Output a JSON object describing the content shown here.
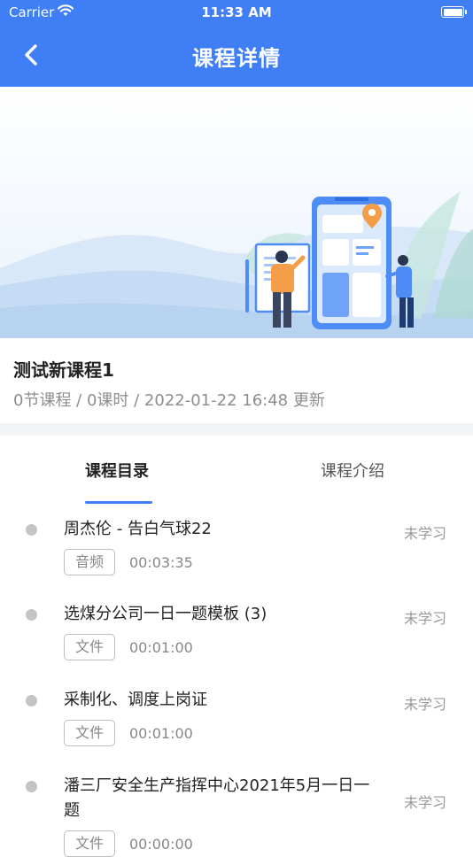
{
  "status_bar": {
    "carrier": "Carrier",
    "time": "11:33 AM"
  },
  "header": {
    "title": "课程详情"
  },
  "course": {
    "title": "测试新课程1",
    "meta": "0节课程 / 0课时 / 2022-01-22 16:48 更新"
  },
  "tabs": [
    {
      "label": "课程目录",
      "active": true
    },
    {
      "label": "课程介绍",
      "active": false
    }
  ],
  "lessons": [
    {
      "title": "周杰伦 - 告白气球22",
      "type": "音频",
      "duration": "00:03:35",
      "status": "未学习"
    },
    {
      "title": "选煤分公司一日一题模板 (3)",
      "type": "文件",
      "duration": "00:01:00",
      "status": "未学习"
    },
    {
      "title": "采制化、调度上岗证",
      "type": "文件",
      "duration": "00:01:00",
      "status": "未学习"
    },
    {
      "title": "潘三厂安全生产指挥中心2021年5月一日一题",
      "type": "文件",
      "duration": "00:00:00",
      "status": "未学习"
    }
  ],
  "colors": {
    "primary": "#3f7ef5",
    "dot": "#c4c4c4",
    "muted": "#999999"
  },
  "icons": {
    "back": "chevron-left-icon",
    "wifi": "wifi-icon",
    "battery": "battery-icon"
  }
}
